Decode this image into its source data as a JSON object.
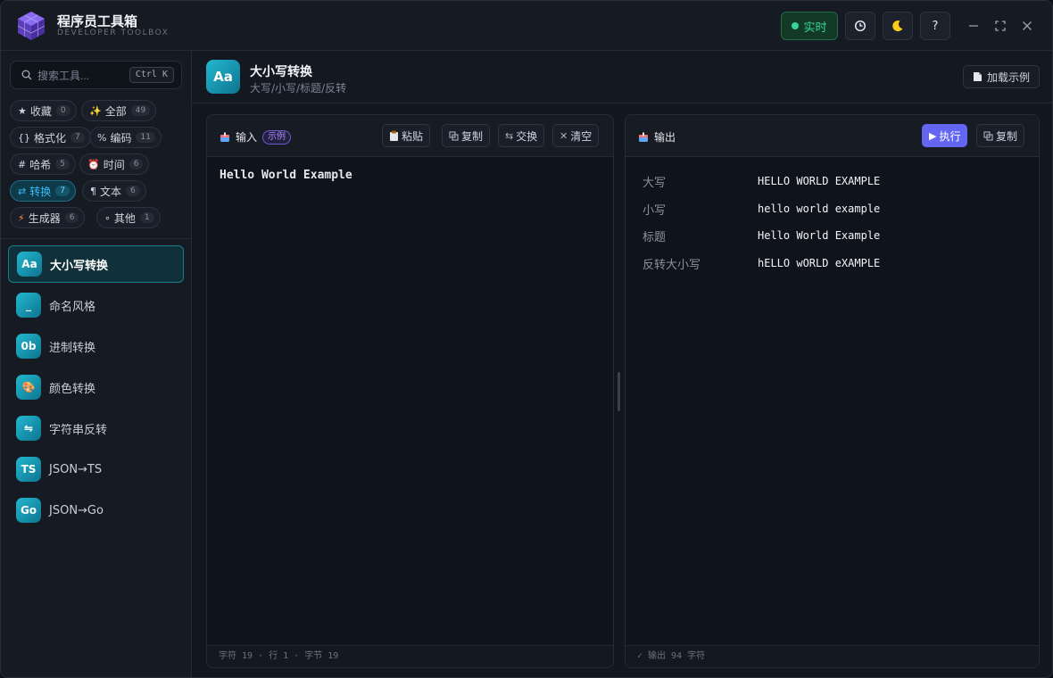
{
  "app": {
    "title": "程序员工具箱",
    "subtitle": "DEVELOPER TOOLBOX"
  },
  "titlebar": {
    "live_label": "实时",
    "history_icon": "clock-icon",
    "theme_icon": "moon-icon",
    "help_label": "?"
  },
  "sidebar": {
    "search": {
      "placeholder": "搜索工具...",
      "shortcut": "Ctrl K"
    },
    "categories": [
      {
        "icon": "★",
        "label": "收藏",
        "count": "0"
      },
      {
        "icon": "✨",
        "label": "全部",
        "count": "49"
      },
      {
        "icon": "{}",
        "label": "格式化",
        "count": "7"
      },
      {
        "icon": "%",
        "label": "编码",
        "count": "11"
      },
      {
        "icon": "#",
        "label": "哈希",
        "count": "5"
      },
      {
        "icon": "⏰",
        "label": "时间",
        "count": "6"
      },
      {
        "icon": "⇄",
        "label": "转换",
        "count": "7"
      },
      {
        "icon": "¶",
        "label": "文本",
        "count": "6"
      },
      {
        "icon": "⚡",
        "label": "生成器",
        "count": "6"
      },
      {
        "icon": "∘",
        "label": "其他",
        "count": "1"
      }
    ],
    "tools": [
      {
        "icon": "Aa",
        "label": "大小写转换"
      },
      {
        "icon": "_",
        "label": "命名风格"
      },
      {
        "icon": "0b",
        "label": "进制转换"
      },
      {
        "icon": "🎨",
        "label": "颜色转换"
      },
      {
        "icon": "⇋",
        "label": "字符串反转"
      },
      {
        "icon": "TS",
        "label": "JSON→TS"
      },
      {
        "icon": "Go",
        "label": "JSON→Go"
      }
    ]
  },
  "tool_header": {
    "icon": "Aa",
    "title": "大小写转换",
    "subtitle": "大写/小写/标题/反转",
    "load_example": "加载示例"
  },
  "input_panel": {
    "title": "输入",
    "tag": "示例",
    "paste": "粘贴",
    "copy": "复制",
    "swap": "交换",
    "clear": "清空",
    "value": "Hello World Example",
    "footer": "字符 19 · 行 1 · 字节 19"
  },
  "output_panel": {
    "title": "输出",
    "run": "执行",
    "copy": "复制",
    "rows": [
      {
        "label": "大写",
        "value": "HELLO WORLD EXAMPLE"
      },
      {
        "label": "小写",
        "value": "hello world example"
      },
      {
        "label": "标题",
        "value": "Hello World Example"
      },
      {
        "label": "反转大小写",
        "value": "hELLO wORLD eXAMPLE"
      }
    ],
    "footer": "✓ 输出 94 字符"
  },
  "colors": {
    "accent": "#22b8cf",
    "run": "#6366f1",
    "live": "#34d399"
  }
}
